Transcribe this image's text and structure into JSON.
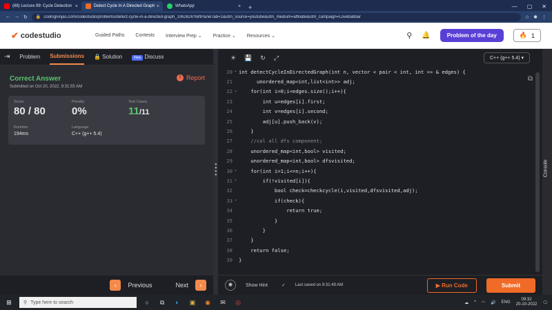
{
  "browser": {
    "tabs": [
      {
        "title": "(68) Lecture 89: Cycle Detection",
        "color": "#ff0000"
      },
      {
        "title": "Detect Cycle In A Directed Graph",
        "color": "#f06b28"
      },
      {
        "title": "WhatsApp",
        "color": "#25d366"
      }
    ],
    "new_tab": "+",
    "url": "codingninjas.com/codestudio/problems/detect-cycle-in-a-directed-graph_1062626?leftPanelTab=1&utm_source=youtube&utm_medium=affiliate&utm_campaign=Lovebabbar"
  },
  "site": {
    "logo": "codestudio",
    "nav": [
      "Guided Paths",
      "Contests",
      "Interview Prep",
      "Practice",
      "Resources"
    ],
    "potd": "Problem of the day",
    "streak": "1"
  },
  "left": {
    "tabs": {
      "problem": "Problem",
      "submissions": "Submissions",
      "solution": "Solution",
      "new": "New",
      "discuss": "Discuss"
    },
    "result_title": "Correct Answer",
    "submitted": "Submitted on Oct 20, 2022, 9:31:55 AM",
    "report": "Report",
    "stats": {
      "score_label": "Score",
      "score": "80 / 80",
      "penalty_label": "Penalty",
      "penalty": "0%",
      "tests_label": "Test Cases",
      "tests_passed": "11",
      "tests_total": "/11",
      "runtime_label": "Runtime",
      "runtime": "194ms",
      "language_label": "Language",
      "language": "C++ (g++ 5.4)"
    },
    "previous": "Previous",
    "next": "Next"
  },
  "editor": {
    "language": "C++ (g++ 5.4)",
    "lines": [
      {
        "n": "20",
        "t": "int detectCycleInDirectedGraph(int n, vector < pair < int, int >> & edges) {",
        "fold": true
      },
      {
        "n": "21",
        "t": "      unordered_map<int,list<int>> adj;"
      },
      {
        "n": "22",
        "t": "    for(int i=0;i<edges.size();i++){",
        "fold": true
      },
      {
        "n": "23",
        "t": "        int u=edges[i].first;"
      },
      {
        "n": "24",
        "t": "        int v=edges[i].second;"
      },
      {
        "n": "25",
        "t": "        adj[u].push_back(v);"
      },
      {
        "n": "26",
        "t": "    }"
      },
      {
        "n": "27",
        "t": "    //cal all dfs component;"
      },
      {
        "n": "28",
        "t": "    unordered_map<int,bool> visited;"
      },
      {
        "n": "29",
        "t": "    unordered_map<int,bool> dfsvisited;"
      },
      {
        "n": "30",
        "t": "    for(int i=1;i<=n;i++){",
        "fold": true
      },
      {
        "n": "31",
        "t": "        if(!visited[i]){",
        "fold": true
      },
      {
        "n": "32",
        "t": "            bool check=checkcycle(i,visited,dfsvisited,adj);"
      },
      {
        "n": "33",
        "t": "            if(check){",
        "fold": true
      },
      {
        "n": "34",
        "t": "                return true;"
      },
      {
        "n": "35",
        "t": "            }"
      },
      {
        "n": "36",
        "t": "        }"
      },
      {
        "n": "37",
        "t": "    }"
      },
      {
        "n": "38",
        "t": "    return false;"
      },
      {
        "n": "39",
        "t": "}"
      }
    ],
    "show_hint": "Show Hint",
    "last_saved": "Last saved on 9:31:49 AM",
    "run": "Run Code",
    "submit": "Submit",
    "console": "Console"
  },
  "taskbar": {
    "search": "Type here to search",
    "lang": "ENG",
    "time": "09:32",
    "date": "20-10-2022"
  }
}
